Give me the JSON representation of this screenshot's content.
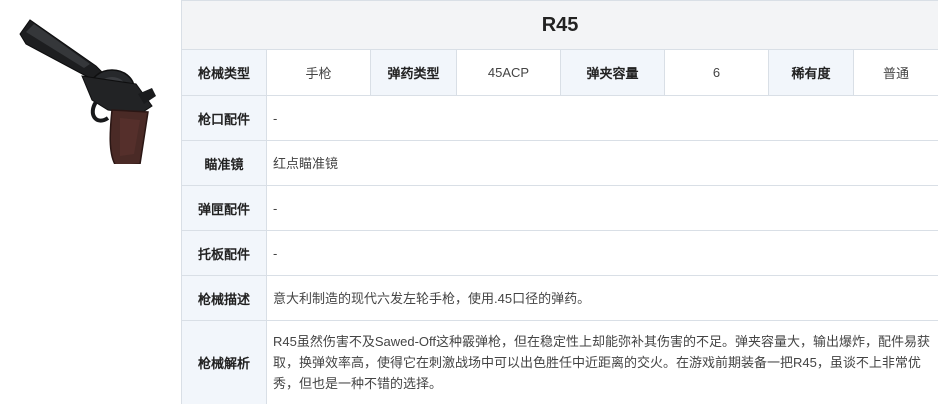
{
  "weapon": {
    "name": "R45",
    "image_alt": "revolver-image"
  },
  "specs": {
    "gun_type_label": "枪械类型",
    "gun_type_value": "手枪",
    "ammo_type_label": "弹药类型",
    "ammo_type_value": "45ACP",
    "mag_capacity_label": "弹夹容量",
    "mag_capacity_value": "6",
    "rarity_label": "稀有度",
    "rarity_value": "普通"
  },
  "attachments": [
    {
      "label": "枪口配件",
      "value": "-"
    },
    {
      "label": "瞄准镜",
      "value": "红点瞄准镜"
    },
    {
      "label": "弹匣配件",
      "value": "-"
    },
    {
      "label": "托板配件",
      "value": "-"
    }
  ],
  "description": {
    "label": "枪械描述",
    "value": "意大利制造的现代六发左轮手枪，使用.45口径的弹药。"
  },
  "analysis": {
    "label": "枪械解析",
    "value": "R45虽然伤害不及Sawed-Off这种霰弹枪，但在稳定性上却能弥补其伤害的不足。弹夹容量大，输出爆炸，配件易获取，换弹效率高，使得它在刺激战场中可以出色胜任中近距离的交火。在游戏前期装备一把R45，虽谈不上非常优秀，但也是一种不错的选择。"
  },
  "colors": {
    "label_bg": "#f2f6fb",
    "title_bg": "#f3f4f6",
    "border": "#d9dfe6"
  }
}
